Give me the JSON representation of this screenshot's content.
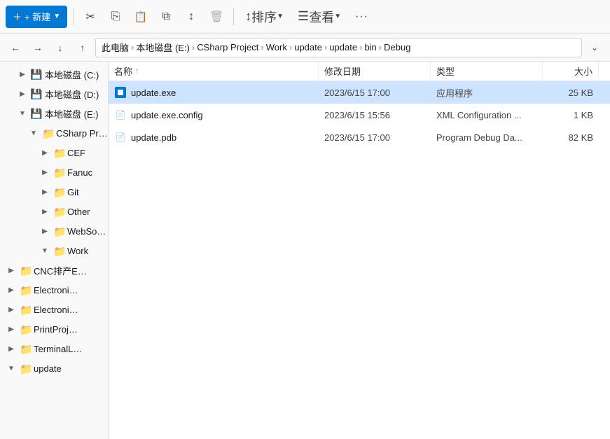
{
  "toolbar": {
    "new_label": "+ 新建",
    "new_dropdown": true,
    "cut_icon": "✂",
    "copy_icon": "⎘",
    "paste_icon": "⏋",
    "copy2_icon": "⧉",
    "move_icon": "⤷",
    "delete_icon": "🗑",
    "sort_label": "排序",
    "view_label": "查看",
    "more_icon": "···"
  },
  "addressbar": {
    "back_disabled": false,
    "forward_disabled": false,
    "up_disabled": false,
    "breadcrumb": [
      {
        "label": "此电脑",
        "sep": true
      },
      {
        "label": "本地磁盘 (E:)",
        "sep": true
      },
      {
        "label": "CSharp Project",
        "sep": true
      },
      {
        "label": "Work",
        "sep": true
      },
      {
        "label": "update",
        "sep": true
      },
      {
        "label": "update",
        "sep": true
      },
      {
        "label": "bin",
        "sep": true
      },
      {
        "label": "Debug",
        "sep": false
      }
    ]
  },
  "sidebar": {
    "items": [
      {
        "id": "local-c",
        "label": "本地磁盘 (C:)",
        "depth": 1,
        "expanded": false,
        "type": "drive"
      },
      {
        "id": "local-d",
        "label": "本地磁盘 (D:)",
        "depth": 1,
        "expanded": false,
        "type": "drive"
      },
      {
        "id": "local-e",
        "label": "本地磁盘 (E:)",
        "depth": 1,
        "expanded": true,
        "type": "drive"
      },
      {
        "id": "csharp",
        "label": "CSharp Proje…",
        "depth": 2,
        "expanded": true,
        "type": "folder"
      },
      {
        "id": "cef",
        "label": "CEF",
        "depth": 3,
        "expanded": false,
        "type": "folder"
      },
      {
        "id": "fanuc",
        "label": "Fanuc",
        "depth": 3,
        "expanded": false,
        "type": "folder"
      },
      {
        "id": "git",
        "label": "Git",
        "depth": 3,
        "expanded": false,
        "type": "folder"
      },
      {
        "id": "other",
        "label": "Other",
        "depth": 3,
        "expanded": false,
        "type": "folder"
      },
      {
        "id": "websocket",
        "label": "WebSocke…",
        "depth": 3,
        "expanded": false,
        "type": "folder"
      },
      {
        "id": "work",
        "label": "Work",
        "depth": 3,
        "expanded": true,
        "type": "folder"
      },
      {
        "id": "cnc",
        "label": "CNC排产E…",
        "depth": 4,
        "expanded": false,
        "type": "folder"
      },
      {
        "id": "electronic1",
        "label": "Electroni…",
        "depth": 4,
        "expanded": false,
        "type": "folder"
      },
      {
        "id": "electronic2",
        "label": "Electroni…",
        "depth": 4,
        "expanded": false,
        "type": "folder"
      },
      {
        "id": "printproj",
        "label": "PrintProj…",
        "depth": 4,
        "expanded": false,
        "type": "folder"
      },
      {
        "id": "terminall",
        "label": "TerminalL…",
        "depth": 4,
        "expanded": false,
        "type": "folder"
      },
      {
        "id": "update",
        "label": "update",
        "depth": 4,
        "expanded": true,
        "type": "folder"
      }
    ]
  },
  "filelist": {
    "columns": [
      {
        "id": "name",
        "label": "名称",
        "sort": "asc"
      },
      {
        "id": "date",
        "label": "修改日期"
      },
      {
        "id": "type",
        "label": "类型"
      },
      {
        "id": "size",
        "label": "大小"
      }
    ],
    "files": [
      {
        "id": "update-exe",
        "name": "update.exe",
        "date": "2023/6/15 17:00",
        "type": "应用程序",
        "size": "25 KB",
        "icon": "exe",
        "selected": true
      },
      {
        "id": "update-exe-config",
        "name": "update.exe.config",
        "date": "2023/6/15 15:56",
        "type": "XML Configuration ...",
        "size": "1 KB",
        "icon": "config",
        "selected": false
      },
      {
        "id": "update-pdb",
        "name": "update.pdb",
        "date": "2023/6/15 17:00",
        "type": "Program Debug Da...",
        "size": "82 KB",
        "icon": "pdb",
        "selected": false
      }
    ]
  }
}
